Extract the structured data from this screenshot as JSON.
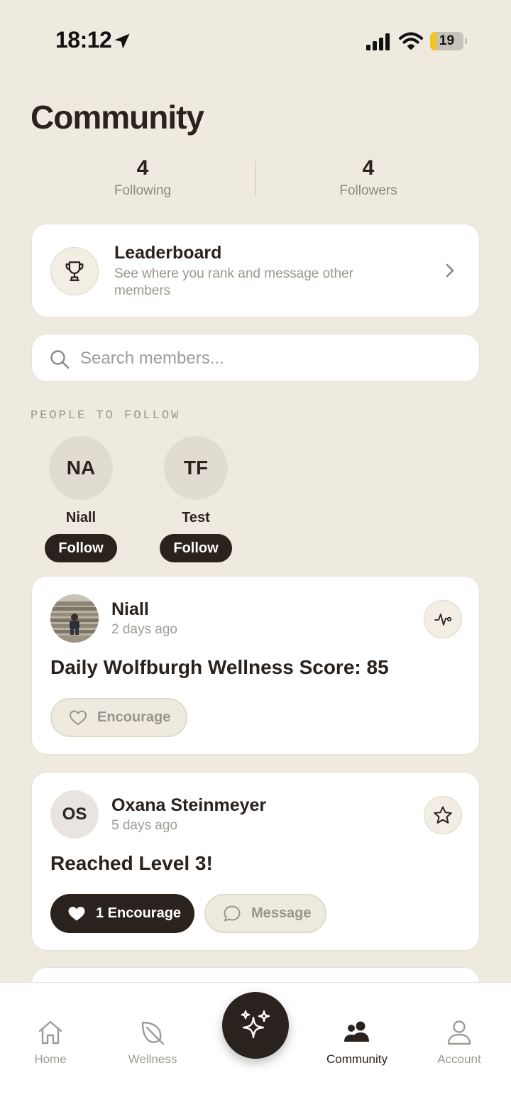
{
  "status_bar": {
    "time": "18:12",
    "battery_level": "19",
    "battery_fraction": 0.19,
    "battery_color": "#F2C523"
  },
  "page": {
    "title": "Community"
  },
  "stats": {
    "following_count": "4",
    "following_label": "Following",
    "followers_count": "4",
    "followers_label": "Followers"
  },
  "leaderboard": {
    "title": "Leaderboard",
    "subtitle": "See where you rank and message other members",
    "icon": "trophy-icon"
  },
  "search": {
    "placeholder": "Search members...",
    "value": ""
  },
  "people_to_follow": {
    "label": "PEOPLE TO FOLLOW",
    "people": [
      {
        "initials": "NA",
        "name": "Niall",
        "button": "Follow"
      },
      {
        "initials": "TF",
        "name": "Test",
        "button": "Follow"
      }
    ]
  },
  "feed": [
    {
      "name": "Niall",
      "time": "2 days ago",
      "title": "Daily Wolfburgh Wellness Score: 85",
      "badge_icon": "pulse-icon",
      "encourage_label": "Encourage",
      "encouraged": false
    },
    {
      "initials": "OS",
      "name": "Oxana Steinmeyer",
      "time": "5 days ago",
      "title": "Reached Level 3!",
      "badge_icon": "star-icon",
      "encourage_label": "1 Encourage",
      "encouraged": true,
      "message_label": "Message"
    }
  ],
  "tab_bar": {
    "tabs": [
      {
        "label": "Home",
        "icon": "home-icon",
        "active": false
      },
      {
        "label": "Wellness",
        "icon": "leaf-icon",
        "active": false
      },
      {
        "label": "Community",
        "icon": "people-icon",
        "active": true
      },
      {
        "label": "Account",
        "icon": "person-icon",
        "active": false
      }
    ],
    "center_action_icon": "sparkles-icon"
  },
  "colors": {
    "background": "#EFEADF",
    "primary_dark": "#2A221D",
    "card": "#FFFFFF",
    "muted_text": "#9A958E"
  }
}
